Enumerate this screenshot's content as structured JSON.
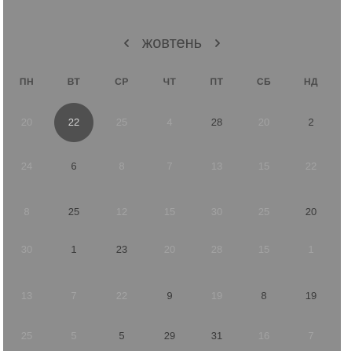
{
  "calendar": {
    "month_label": "жовтень",
    "prev_icon": "chevron-left-icon",
    "next_icon": "chevron-right-icon",
    "weekdays": [
      "ПН",
      "ВТ",
      "СР",
      "ЧТ",
      "ПТ",
      "СБ",
      "НД"
    ],
    "rows": [
      [
        {
          "label": "20",
          "muted": true
        },
        {
          "label": "22",
          "muted": false,
          "selected": true
        },
        {
          "label": "25",
          "muted": true
        },
        {
          "label": "4",
          "muted": true
        },
        {
          "label": "28",
          "muted": false
        },
        {
          "label": "20",
          "muted": true
        },
        {
          "label": "2",
          "muted": false
        }
      ],
      [
        {
          "label": "24",
          "muted": true
        },
        {
          "label": "6",
          "muted": false
        },
        {
          "label": "8",
          "muted": true
        },
        {
          "label": "7",
          "muted": true
        },
        {
          "label": "13",
          "muted": true
        },
        {
          "label": "15",
          "muted": true
        },
        {
          "label": "22",
          "muted": true
        }
      ],
      [
        {
          "label": "8",
          "muted": true
        },
        {
          "label": "25",
          "muted": false
        },
        {
          "label": "12",
          "muted": true
        },
        {
          "label": "15",
          "muted": true
        },
        {
          "label": "30",
          "muted": true
        },
        {
          "label": "25",
          "muted": true
        },
        {
          "label": "20",
          "muted": false
        }
      ],
      [
        {
          "label": "30",
          "muted": true
        },
        {
          "label": "1",
          "muted": false
        },
        {
          "label": "23",
          "muted": false
        },
        {
          "label": "20",
          "muted": true
        },
        {
          "label": "28",
          "muted": true
        },
        {
          "label": "15",
          "muted": true
        },
        {
          "label": "1",
          "muted": true
        }
      ],
      [
        {
          "label": "13",
          "muted": true
        },
        {
          "label": "7",
          "muted": true
        },
        {
          "label": "22",
          "muted": true
        },
        {
          "label": "9",
          "muted": false
        },
        {
          "label": "19",
          "muted": true
        },
        {
          "label": "8",
          "muted": false
        },
        {
          "label": "19",
          "muted": false
        }
      ],
      [
        {
          "label": "25",
          "muted": true
        },
        {
          "label": "5",
          "muted": true
        },
        {
          "label": "5",
          "muted": false
        },
        {
          "label": "29",
          "muted": false
        },
        {
          "label": "31",
          "muted": false
        },
        {
          "label": "16",
          "muted": true
        },
        {
          "label": "7",
          "muted": true
        }
      ]
    ]
  },
  "colors": {
    "panel_bg": "#8d8d8d",
    "selected_bg": "#505050",
    "text": "#3a3a3a",
    "muted_text": "#a3a3a3"
  }
}
